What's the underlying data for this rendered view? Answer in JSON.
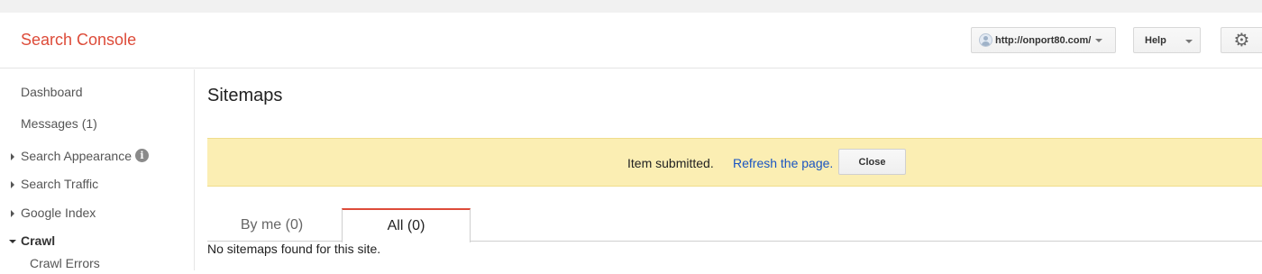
{
  "header": {
    "app_title": "Search Console",
    "site_selector": {
      "value": "http://onport80.com/"
    },
    "help_label": "Help",
    "gear_icon": "gear-icon"
  },
  "sidebar": {
    "items": [
      {
        "label": "Dashboard",
        "expand": "none"
      },
      {
        "label": "Messages (1)",
        "expand": "none"
      },
      {
        "label": "Search Appearance",
        "expand": "collapsed",
        "icon": "info-icon"
      },
      {
        "label": "Search Traffic",
        "expand": "collapsed"
      },
      {
        "label": "Google Index",
        "expand": "collapsed"
      },
      {
        "label": "Crawl",
        "expand": "expanded"
      },
      {
        "label": "Crawl Errors",
        "expand": "child"
      }
    ]
  },
  "main": {
    "title": "Sitemaps",
    "notice": {
      "text": "Item submitted.",
      "link": "Refresh the page.",
      "close_label": "Close"
    },
    "tabs": [
      {
        "label": "By me (0)",
        "active": false
      },
      {
        "label": "All (0)",
        "active": true
      }
    ],
    "empty_message": "No sitemaps found for this site."
  },
  "colors": {
    "brand": "#dd4b39",
    "notice_bg": "#fbeeb3",
    "link": "#1a55c2"
  }
}
